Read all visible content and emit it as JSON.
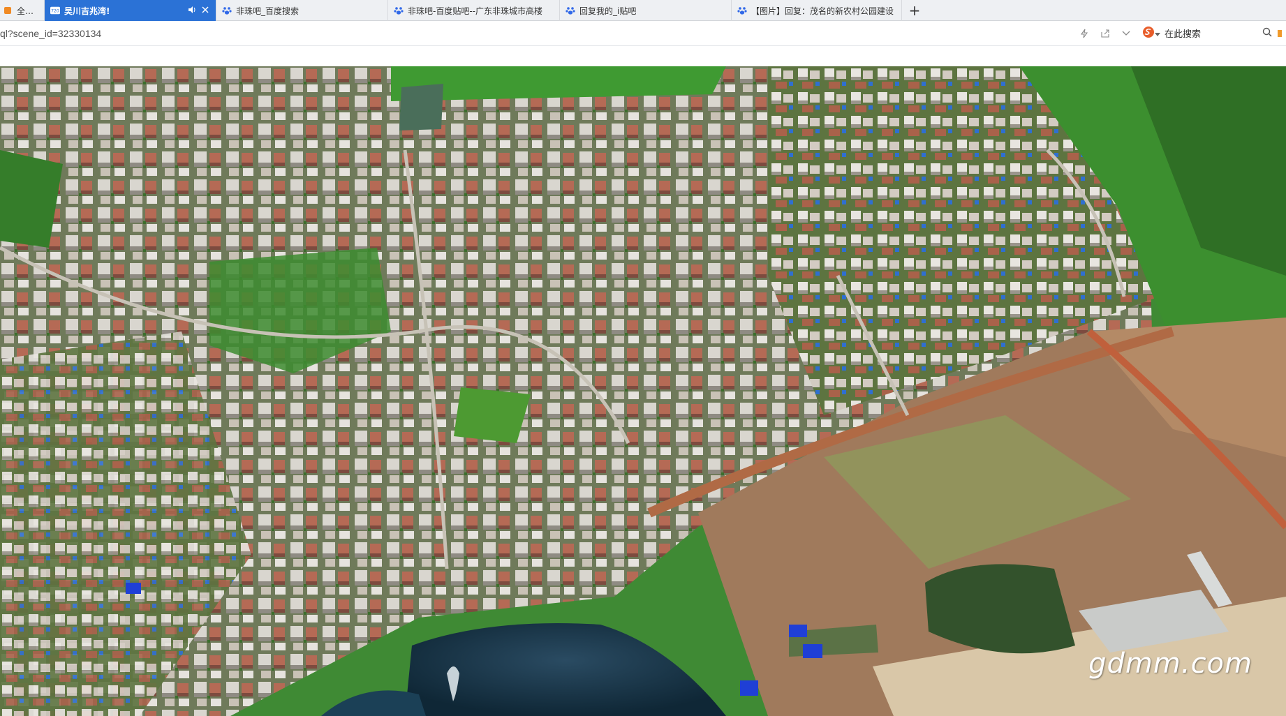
{
  "tabs": [
    {
      "label": "全最摄影",
      "icon": "app-icon",
      "active": false
    },
    {
      "label": "吴川吉兆湾!",
      "icon": "720-icon",
      "active": true
    },
    {
      "label": "非珠吧_百度搜索",
      "icon": "baidu-paw-icon",
      "active": false
    },
    {
      "label": "非珠吧-百度贴吧--广东非珠城市高楼",
      "icon": "baidu-paw-icon",
      "active": false
    },
    {
      "label": "回复我的_i贴吧",
      "icon": "baidu-paw-icon",
      "active": false
    },
    {
      "label": "【图片】回复：茂名的新农村公园建设",
      "icon": "baidu-paw-icon",
      "active": false
    }
  ],
  "active_tab_badge": "720",
  "new_tab_label": "+",
  "address": {
    "url_text": "ql?scene_id=32330134"
  },
  "search": {
    "placeholder": "在此搜索"
  },
  "watermark": "gdmm.com",
  "colors": {
    "tab_active": "#2b72d6",
    "tab_bar": "#eef0f3",
    "baidu_blue": "#3068e8",
    "sogou_orange": "#e85d2a"
  }
}
